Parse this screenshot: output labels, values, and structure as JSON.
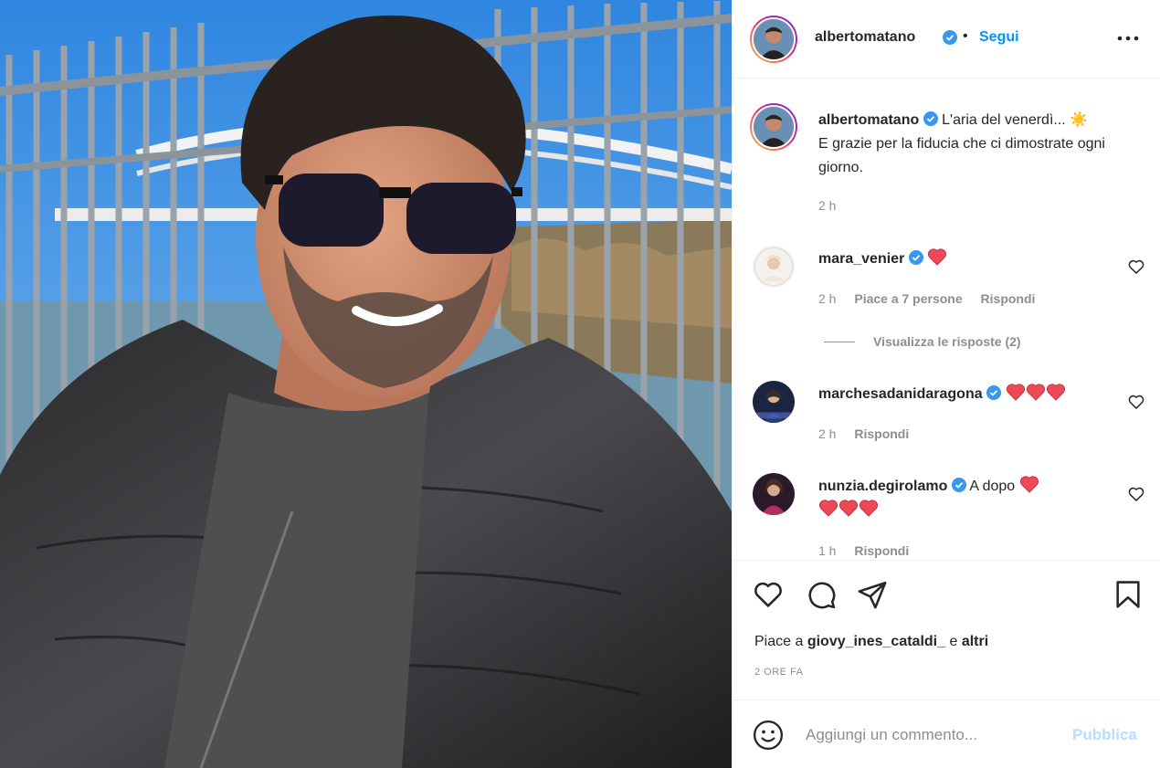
{
  "photo": {
    "alt_icon": "post-photo"
  },
  "header": {
    "username": "albertomatano",
    "dot": "•",
    "follow_label": "Segui",
    "more_icon": "more-options-icon"
  },
  "caption": {
    "username": "albertomatano",
    "text": "L'aria del venerdì... ☀️",
    "text_line2": "E grazie per la fiducia che ci dimostrate ogni giorno.",
    "time": "2 h"
  },
  "comments": [
    {
      "username": "mara_venier",
      "text": "",
      "hearts": 1,
      "time": "2 h",
      "likes": "Piace a 7 persone",
      "reply": "Rispondi"
    },
    {
      "username": "marchesadanidaragona",
      "text": "",
      "hearts": 3,
      "time": "2 h",
      "reply": "Rispondi"
    },
    {
      "username": "nunzia.degirolamo",
      "text": "A dopo",
      "hearts": 1,
      "hearts_line2": 3,
      "time": "1 h",
      "reply": "Rispondi"
    }
  ],
  "view_replies": "Visualizza le risposte (2)",
  "actions": {
    "like_icon": "heart-icon",
    "comment_icon": "comment-icon",
    "share_icon": "share-icon",
    "save_icon": "bookmark-icon"
  },
  "likes": {
    "prefix": "Piace a",
    "user": "giovy_ines_cataldi_",
    "middle": "e",
    "suffix": "altri"
  },
  "timeago": "2 ORE FA",
  "add_comment": {
    "placeholder": "Aggiungi un commento...",
    "publish_label": "Pubblica"
  },
  "colors": {
    "accent": "#0095f6",
    "publish_disabled": "#b2dffc",
    "heart_red": "#ed4956",
    "verified": "#3897f0"
  }
}
